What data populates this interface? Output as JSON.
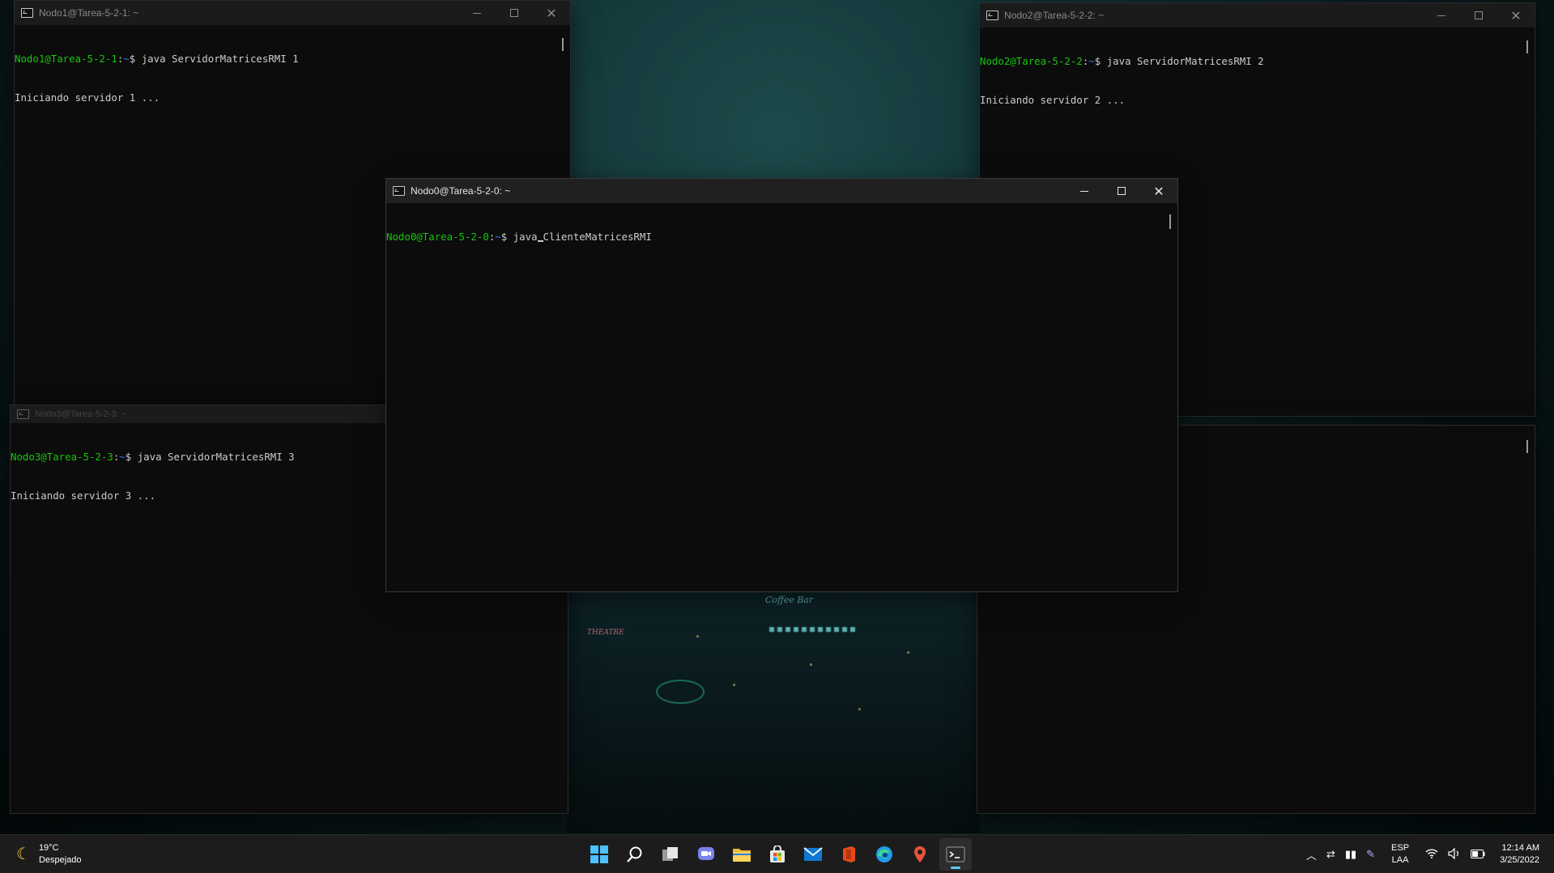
{
  "terminals": {
    "nodo1": {
      "title": "Nodo1@Tarea-5-2-1: ~",
      "prompt_user": "Nodo1@Tarea-5-2-1",
      "prompt_sep": ":",
      "prompt_path": "~",
      "prompt_symbol": "$ ",
      "command": "java ServidorMatricesRMI 1",
      "output": "Iniciando servidor 1 ..."
    },
    "nodo2": {
      "title": "Nodo2@Tarea-5-2-2: ~",
      "prompt_user": "Nodo2@Tarea-5-2-2",
      "prompt_sep": ":",
      "prompt_path": "~",
      "prompt_symbol": "$ ",
      "command": "java ServidorMatricesRMI 2",
      "output": "Iniciando servidor 2 ..."
    },
    "nodo3": {
      "title": "Nodo3@Tarea-5-2-3: ~",
      "prompt_user": "Nodo3@Tarea-5-2-3",
      "prompt_sep": ":",
      "prompt_path": "~",
      "prompt_symbol": "$ ",
      "command": "java ServidorMatricesRMI 3",
      "output": "Iniciando servidor 3 ..."
    },
    "nodo0": {
      "title": "Nodo0@Tarea-5-2-0: ~",
      "prompt_user": "Nodo0@Tarea-5-2-0",
      "prompt_sep": ":",
      "prompt_path": "~",
      "prompt_symbol": "$ ",
      "command_a": "java",
      "command_b": "ClienteMatricesRMI"
    }
  },
  "wallpaper": {
    "sign_text": "Coffee Bar",
    "sign_text_2": "THEATRE"
  },
  "taskbar": {
    "weather_temp": "19°C",
    "weather_desc": "Despejado",
    "apps": [
      "start-icon",
      "search-icon",
      "task-view-icon",
      "chat-icon",
      "file-explorer-icon",
      "store-icon",
      "mail-icon",
      "office-icon",
      "edge-icon",
      "maps-icon",
      "terminal-icon"
    ],
    "lang_top": "ESP",
    "lang_bottom": "LAA",
    "time": "12:14 AM",
    "date": "3/25/2022"
  },
  "colors": {
    "prompt_user": "#16c60c",
    "prompt_path": "#3b78ff",
    "terminal_bg": "#0c0c0c",
    "accent": "#60cdff"
  }
}
